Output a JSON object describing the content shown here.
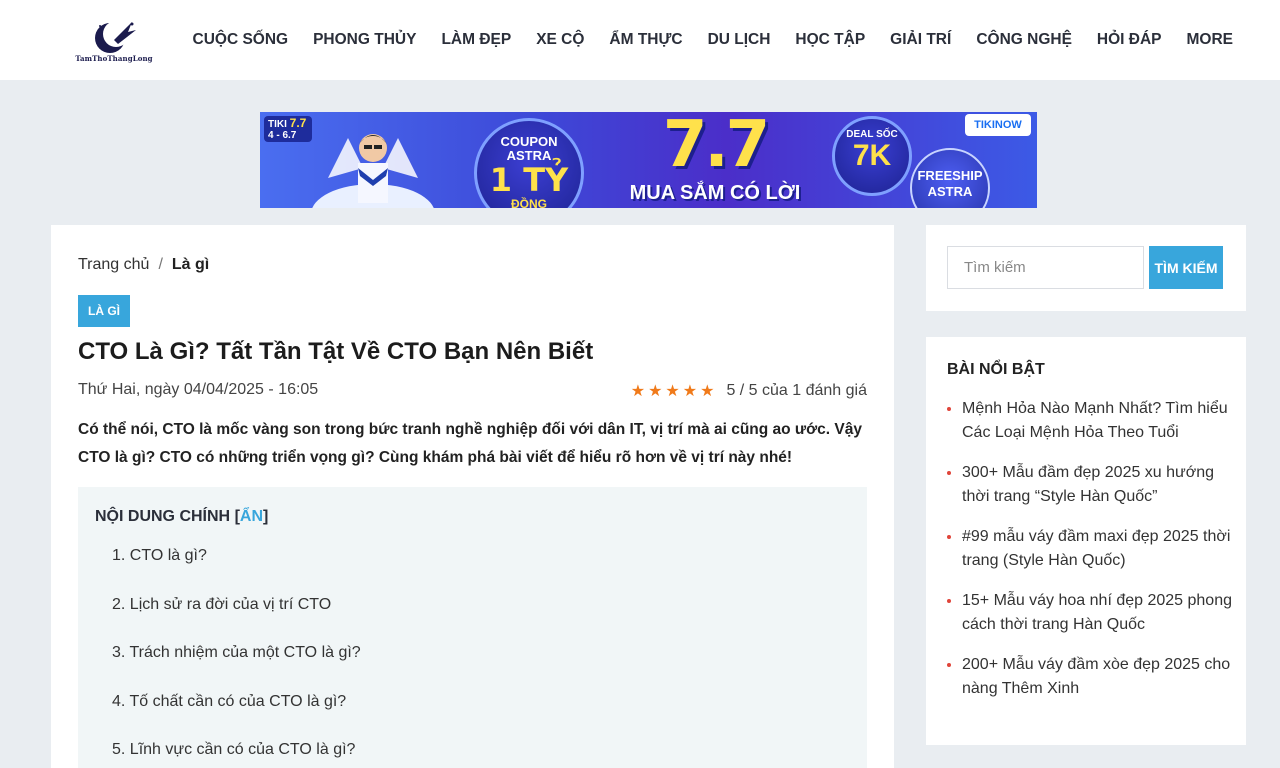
{
  "header": {
    "logo_text": "TamThoThangLong",
    "nav": [
      "CUỘC SỐNG",
      "PHONG THỦY",
      "LÀM ĐẸP",
      "XE CỘ",
      "ẨM THỰC",
      "DU LỊCH",
      "HỌC TẬP",
      "GIẢI TRÍ",
      "CÔNG NGHỆ",
      "HỎI ĐÁP",
      "MORE"
    ]
  },
  "banner": {
    "tiki_label": "TIKI",
    "tiki_num": "7.7",
    "tiki_dates": "4 - 6.7",
    "coupon_line1": "COUPON",
    "coupon_line2": "ASTRA",
    "coupon_amount": "1 TỶ",
    "coupon_unit": "ĐỒNG",
    "big_number": "7.7",
    "slogan": "MUA SẮM CÓ LỜI",
    "deal_label": "DEAL SỐC",
    "deal_value": "7K",
    "freeship_line1": "FREESHIP",
    "freeship_line2": "ASTRA",
    "tikinow": "TIKINOW",
    "colors": {
      "accent": "#ffe14b",
      "bg": "#3d49d8"
    }
  },
  "breadcrumb": {
    "home": "Trang chủ",
    "separator": "/",
    "current": "Là gì"
  },
  "article": {
    "category": "LÀ GÌ",
    "title": "CTO Là Gì? Tất Tần Tật Về CTO Bạn Nên Biết",
    "date": "Thứ Hai, ngày 04/04/2025 - 16:05",
    "rating_stars": 5,
    "rating_text": "5 / 5 của 1 đánh giá",
    "intro": "Có thể nói, CTO là mốc vàng son trong bức tranh nghề nghiệp đối với dân IT, vị trí mà ai cũng ao ước. Vậy CTO là gì? CTO có những triển vọng gì? Cùng khám phá bài viết để hiểu rõ hơn về vị trí này nhé!"
  },
  "toc": {
    "title": "NỘI DUNG CHÍNH",
    "toggle_open": "[",
    "toggle_label": "ẨN",
    "toggle_close": "]",
    "items": [
      "1. CTO là gì?",
      "2. Lịch sử ra đời của vị trí CTO",
      "3. Trách nhiệm của một CTO là gì?",
      "4. Tố chất cần có của CTO là gì?",
      "5. Lĩnh vực cần có của CTO là gì?"
    ]
  },
  "search": {
    "placeholder": "Tìm kiếm",
    "button": "TÌM KIẾM"
  },
  "featured": {
    "title": "BÀI NỔI BẬT",
    "items": [
      "Mệnh Hỏa Nào Mạnh Nhất? Tìm hiểu Các Loại Mệnh Hỏa Theo Tuổi",
      "300+ Mẫu đầm đẹp 2025 xu hướng thời trang “Style Hàn Quốc”",
      "#99 mẫu váy đầm maxi đẹp 2025 thời trang (Style Hàn Quốc)",
      "15+ Mẫu váy hoa nhí đẹp 2025 phong cách thời trang Hàn Quốc",
      "200+ Mẫu váy đầm xòe đẹp 2025 cho nàng Thêm Xinh"
    ]
  },
  "colors": {
    "accent": "#38a6dc",
    "star": "#f07a1a",
    "bullet": "#e0453a",
    "page_bg": "#e9edf1"
  }
}
